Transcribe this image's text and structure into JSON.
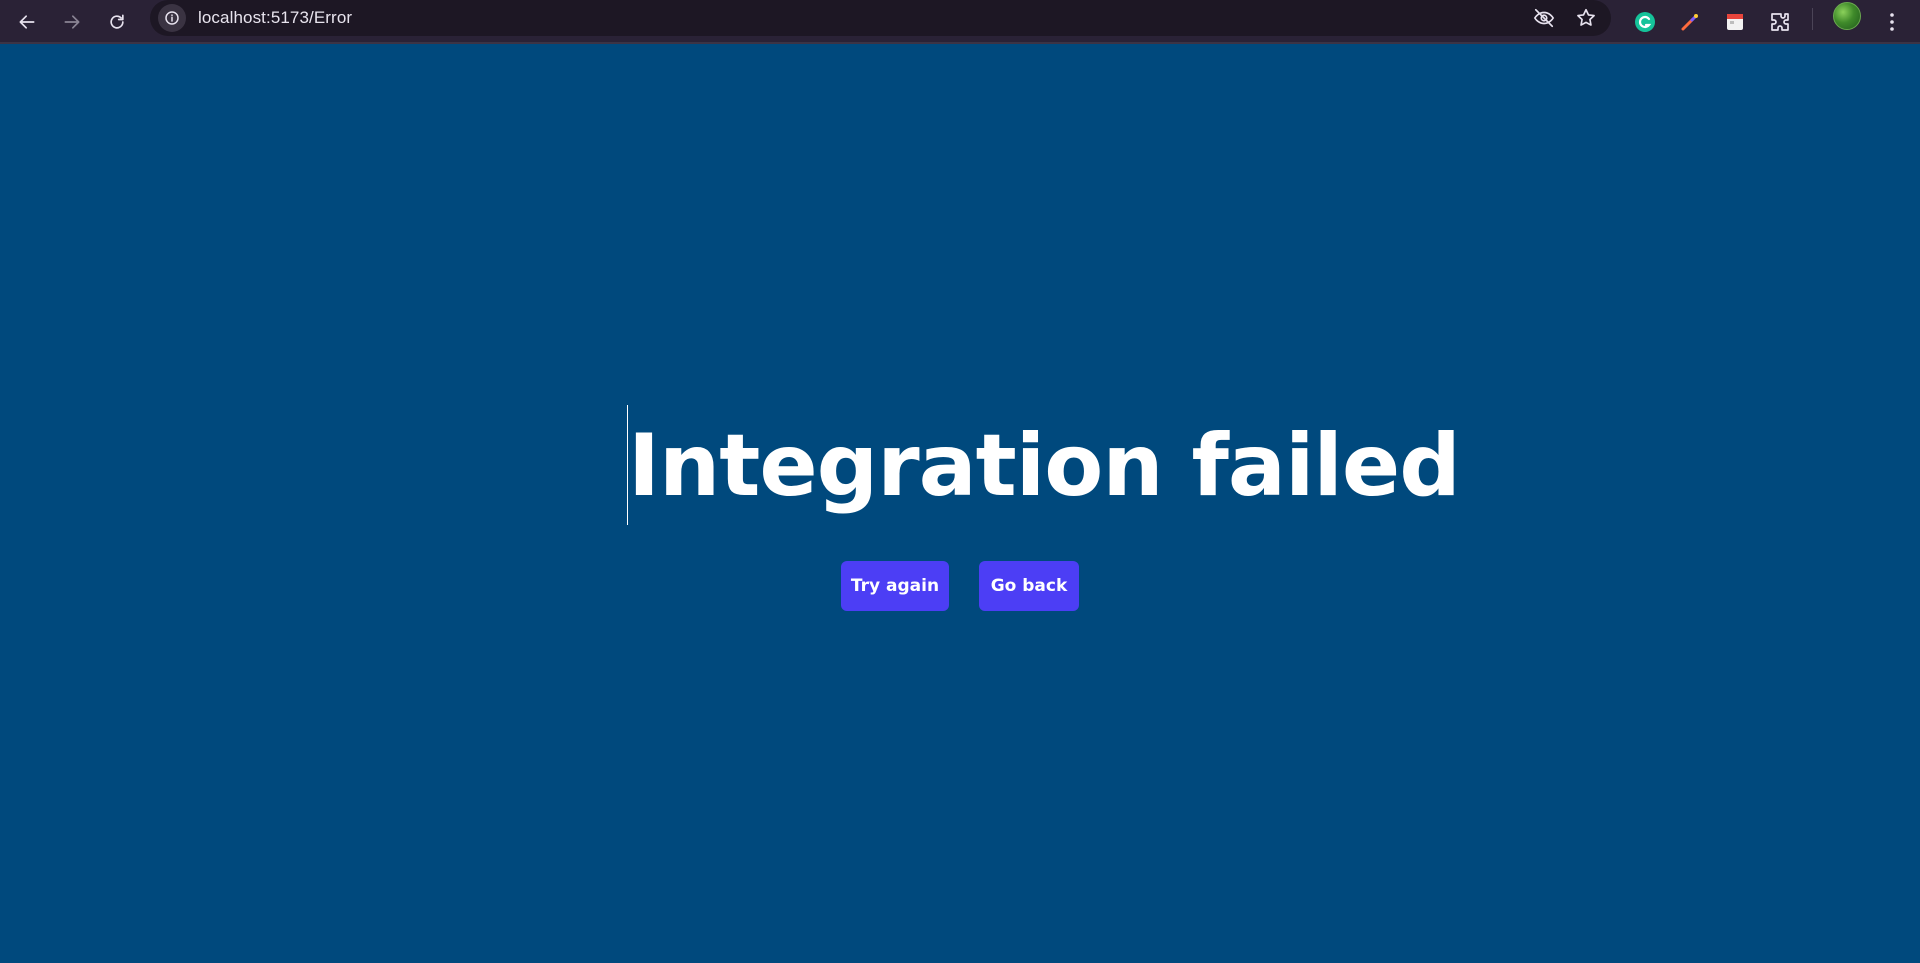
{
  "browser": {
    "url": "localhost:5173/Error",
    "icons": {
      "back": "arrow-left-icon",
      "forward": "arrow-right-icon",
      "reload": "reload-icon",
      "site_info": "info-icon",
      "tracking": "eye-off-icon",
      "bookmark": "star-icon",
      "ext1": "grammarly-icon",
      "ext2": "color-picker-icon",
      "ext3": "calendar-icon",
      "extensions": "puzzle-icon",
      "profile": "avatar",
      "menu": "kebab-menu-icon"
    }
  },
  "page": {
    "title": "Integration failed",
    "try_again_label": "Try again",
    "go_back_label": "Go back"
  },
  "colors": {
    "background": "#00497d",
    "button": "#4c3ef5",
    "topbar": "#2a2236"
  }
}
